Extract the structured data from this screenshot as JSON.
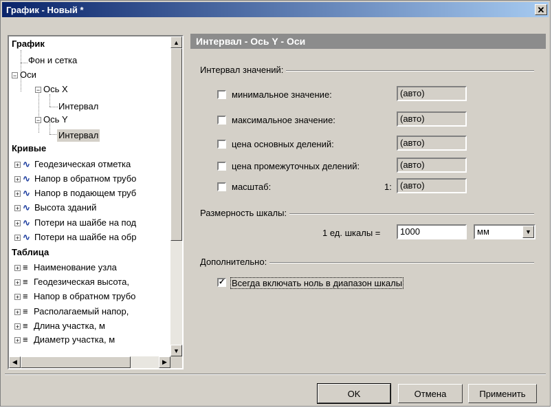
{
  "window": {
    "title": "График - Новый *",
    "close_glyph": "✕"
  },
  "tree": {
    "section_graph": "График",
    "background_grid": "Фон и сетка",
    "axes": "Оси",
    "axis_x": "Ось X",
    "axis_x_interval": "Интервал",
    "axis_y": "Ось Y",
    "axis_y_interval": "Интервал",
    "section_curves": "Кривые",
    "curves": [
      "Геодезическая отметка",
      "Напор в обратном трубо",
      "Напор в подающем труб",
      "Высота зданий",
      "Потери на шайбе на под",
      "Потери на шайбе на обр"
    ],
    "section_table": "Таблица",
    "table_items": [
      "Наименование узла",
      "Геодезическая высота,",
      "Напор в обратном трубо",
      "Располагаемый напор,",
      "Длина участка, м",
      "Диаметр участка, м"
    ],
    "curve_icon": "wave-icon",
    "table_icon": "lines-icon"
  },
  "panel": {
    "header": "Интервал - Ось Y - Оси",
    "group_interval": "Интервал значений:",
    "rows": [
      {
        "label": "минимальное значение:",
        "value": "(авто)",
        "checked": false
      },
      {
        "label": "максимальное значение:",
        "value": "(авто)",
        "checked": false
      },
      {
        "label": "цена основных делений:",
        "value": "(авто)",
        "checked": false
      },
      {
        "label": "цена промежуточных делений:",
        "value": "(авто)",
        "checked": false
      },
      {
        "label": "масштаб:",
        "value": "(авто)",
        "checked": false,
        "prefix": "1:"
      }
    ],
    "group_scale": "Размерность шкалы:",
    "scale_label": "1 ед. шкалы =",
    "scale_value": "1000",
    "scale_unit": "мм",
    "group_extra": "Дополнительно:",
    "include_zero_label": "Всегда включать ноль в диапазон шкалы",
    "include_zero_checked": true
  },
  "buttons": {
    "ok": "OK",
    "cancel": "Отмена",
    "apply": "Применить"
  }
}
